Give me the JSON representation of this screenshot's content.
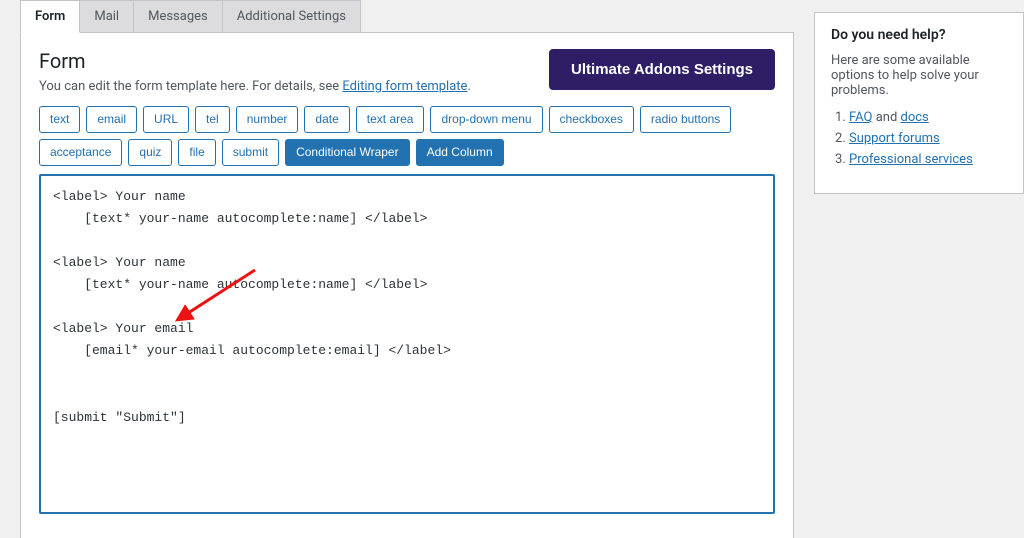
{
  "tabs": {
    "form": "Form",
    "mail": "Mail",
    "messages": "Messages",
    "additional": "Additional Settings"
  },
  "panel": {
    "title": "Form",
    "desc_prefix": "You can edit the form template here. For details, see ",
    "desc_link": "Editing form template",
    "desc_suffix": ".",
    "addons_button": "Ultimate Addons Settings"
  },
  "tags": {
    "text": "text",
    "email": "email",
    "url": "URL",
    "tel": "tel",
    "number": "number",
    "date": "date",
    "textarea": "text area",
    "dropdown": "drop-down menu",
    "checkboxes": "checkboxes",
    "radio": "radio buttons",
    "acceptance": "acceptance",
    "quiz": "quiz",
    "file": "file",
    "submit": "submit",
    "conditional": "Conditional Wraper",
    "addcolumn": "Add Column"
  },
  "editor_value": "<label> Your name\n    [text* your-name autocomplete:name] </label>\n\n<label> Your name\n    [text* your-name autocomplete:name] </label>\n\n<label> Your email\n    [email* your-email autocomplete:email] </label>\n\n\n[submit \"Submit\"]",
  "sidebar": {
    "title": "Do you need help?",
    "intro": "Here are some available options to help solve your problems.",
    "items": [
      {
        "prefix_link": "FAQ",
        "middle": " and ",
        "suffix_link": "docs"
      },
      {
        "prefix_link": "Support forums",
        "middle": "",
        "suffix_link": ""
      },
      {
        "prefix_link": "Professional services",
        "middle": "",
        "suffix_link": ""
      }
    ]
  }
}
